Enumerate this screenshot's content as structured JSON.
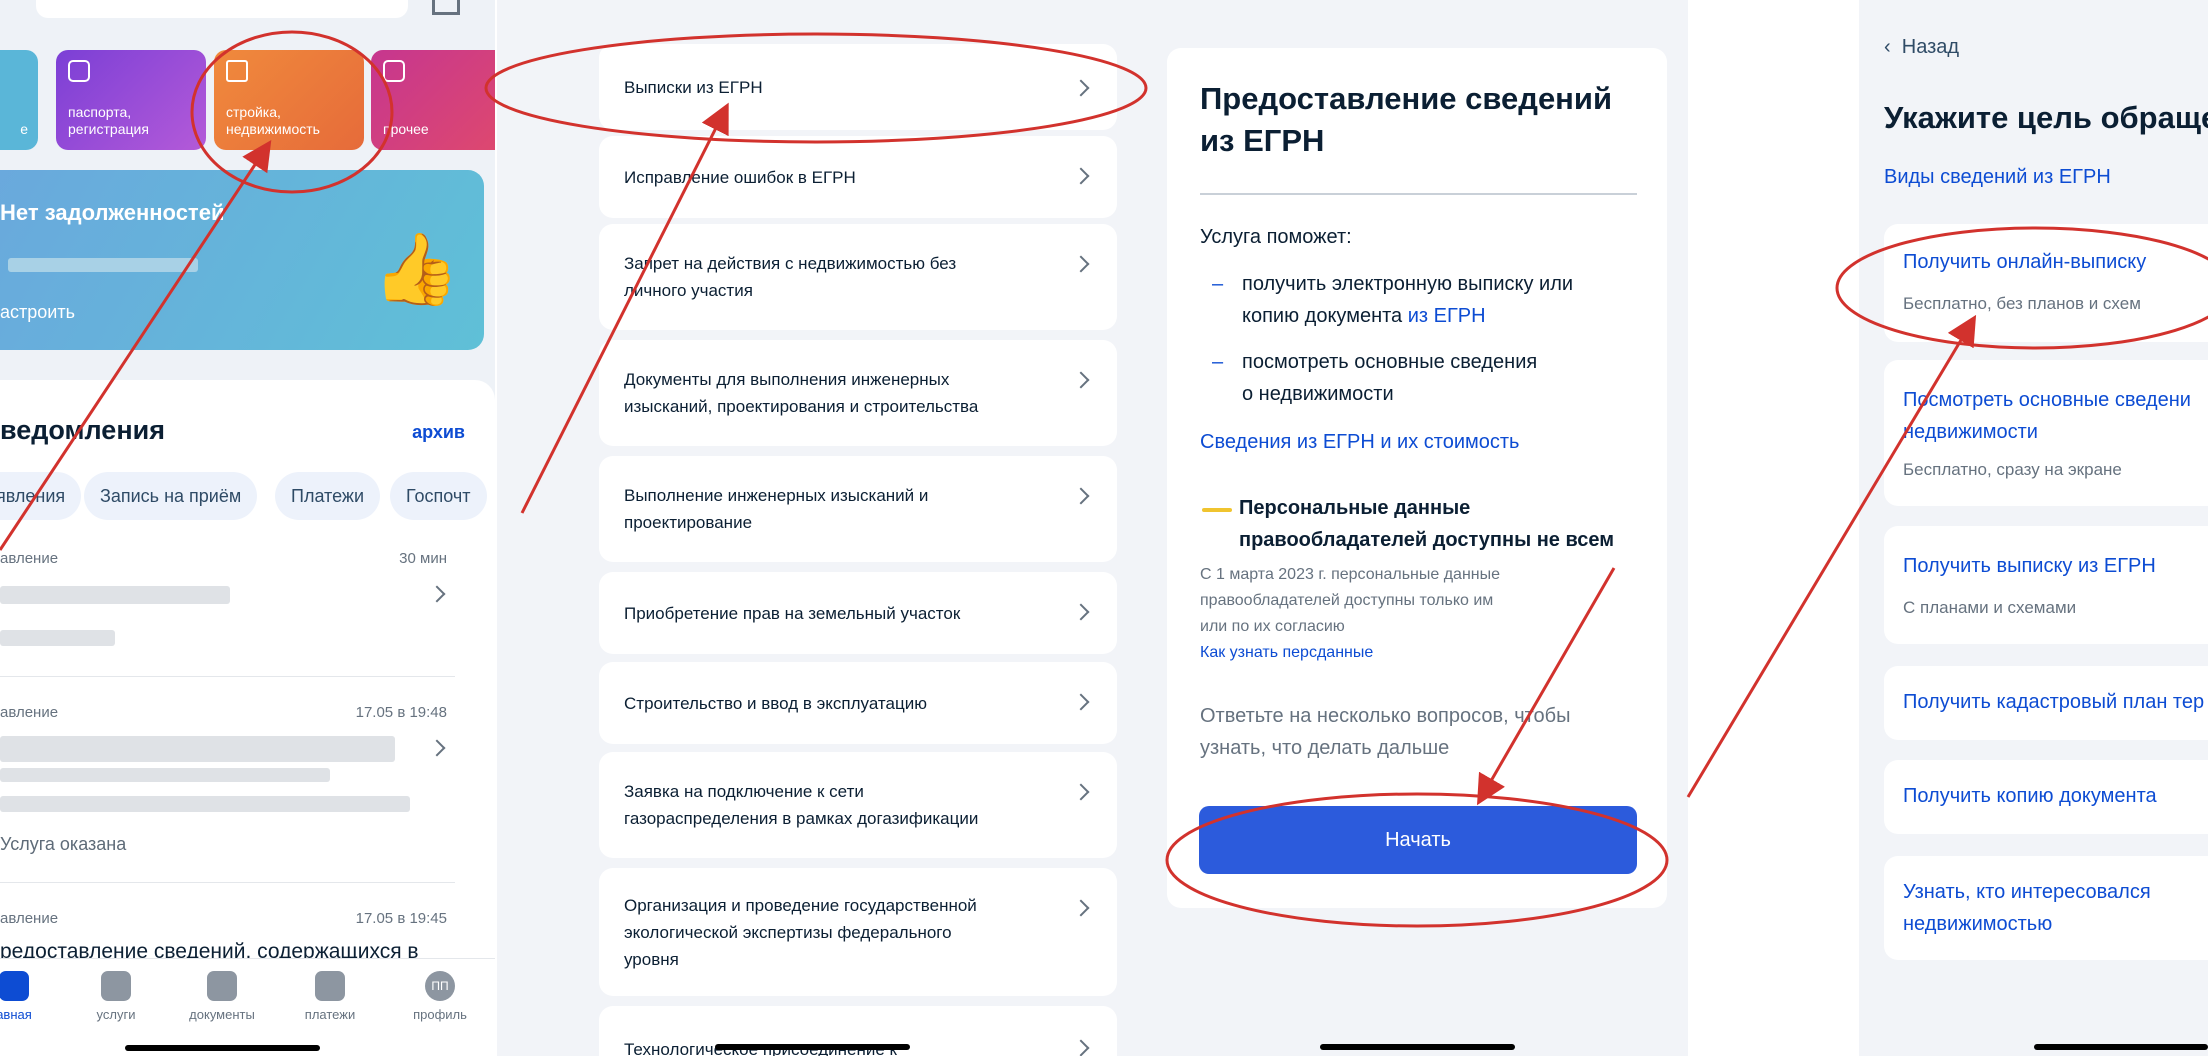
{
  "panel1": {
    "tiles": [
      {
        "label": "е",
        "icon": "tile-icon",
        "color": "#5ab6d8"
      },
      {
        "label": "паспорта,\nрегистрация",
        "icon": "passport-icon",
        "color": "#8c4dd6"
      },
      {
        "label": "стройка,\nнедвижимость",
        "icon": "house-icon",
        "color": "#ee7d3f"
      },
      {
        "label": "прочее",
        "icon": "grid-icon",
        "color": "#c33a8e"
      }
    ],
    "banner": {
      "title": "Нет задолженностей",
      "action": "астроить"
    },
    "notifications_title": "ведомления",
    "archive": "архив",
    "chips": [
      "аявления",
      "Запись на приём",
      "Платежи",
      "Госпочт"
    ],
    "items": [
      {
        "type": "авление",
        "time": "30 мин"
      },
      {
        "type": "авление",
        "time": "17.05 в 19:48",
        "status": "Услуга оказана"
      },
      {
        "type": "авление",
        "time": "17.05 в 19:45",
        "text": "редоставление сведений, содержащихся в"
      }
    ],
    "tabs": [
      {
        "label": "авная",
        "icon": "home-icon"
      },
      {
        "label": "услуги",
        "icon": "services-icon"
      },
      {
        "label": "документы",
        "icon": "documents-icon"
      },
      {
        "label": "платежи",
        "icon": "wallet-icon"
      },
      {
        "label": "профиль",
        "icon": "profile-icon",
        "initials": "ПП"
      }
    ]
  },
  "panel2": {
    "items": [
      "Выписки из ЕГРН",
      "Исправление ошибок в ЕГРН",
      "Запрет на действия с недвижимостью без\nличного участия",
      "Документы для выполнения инженерных\nизысканий, проектирования и строительства",
      "Выполнение инженерных изысканий и\nпроектирование",
      "Приобретение прав на земельный участок",
      "Строительство и ввод в эксплуатацию",
      "Заявка на подключение к сети\nгазораспределения в рамках догазификации",
      "Организация и проведение государственной\nэкологической экспертизы федерального\nуровня",
      "Технологическое присоединение к"
    ]
  },
  "panel3": {
    "title": "Предоставление сведений из ЕГРН",
    "helps": "Услуга поможет:",
    "bullet1_a": "получить электронную выписку или",
    "bullet1_b": "копию документа ",
    "bullet1_link": "из ЕГРН",
    "bullet2_a": "посмотреть основные сведения",
    "bullet2_b": "о недвижимости",
    "cost_link": "Сведения из ЕГРН и их стоимость",
    "warn_a": "Персональные данные",
    "warn_b": "правообладателей доступны не всем",
    "small_a": "С 1 марта 2023 г. персональные данные",
    "small_b": "правообладателей доступны только им",
    "small_c": "или по их согласию",
    "small_link": "Как узнать персданные",
    "answer_a": "Ответьте на несколько вопросов, чтобы",
    "answer_b": "узнать, что делать дальше",
    "button": "Начать",
    "button_color": "#2c5bdc"
  },
  "panel4": {
    "back": "Назад",
    "title": "Укажите цель обраще",
    "subtitle": "Виды сведений из ЕГРН",
    "options": [
      {
        "title": "Получить онлайн-выписку",
        "sub": "Бесплатно, без планов и схем"
      },
      {
        "title": "Посмотреть основные сведени",
        "title2": "недвижимости",
        "sub": "Бесплатно, сразу на экране"
      },
      {
        "title": "Получить выписку из ЕГРН",
        "sub": "С планами и схемами"
      },
      {
        "title": "Получить кадастровый план тер"
      },
      {
        "title": "Получить копию документа"
      },
      {
        "title": "Узнать, кто интересовался",
        "title2": "недвижимостью"
      }
    ]
  },
  "annotation_color": "#d2322d"
}
